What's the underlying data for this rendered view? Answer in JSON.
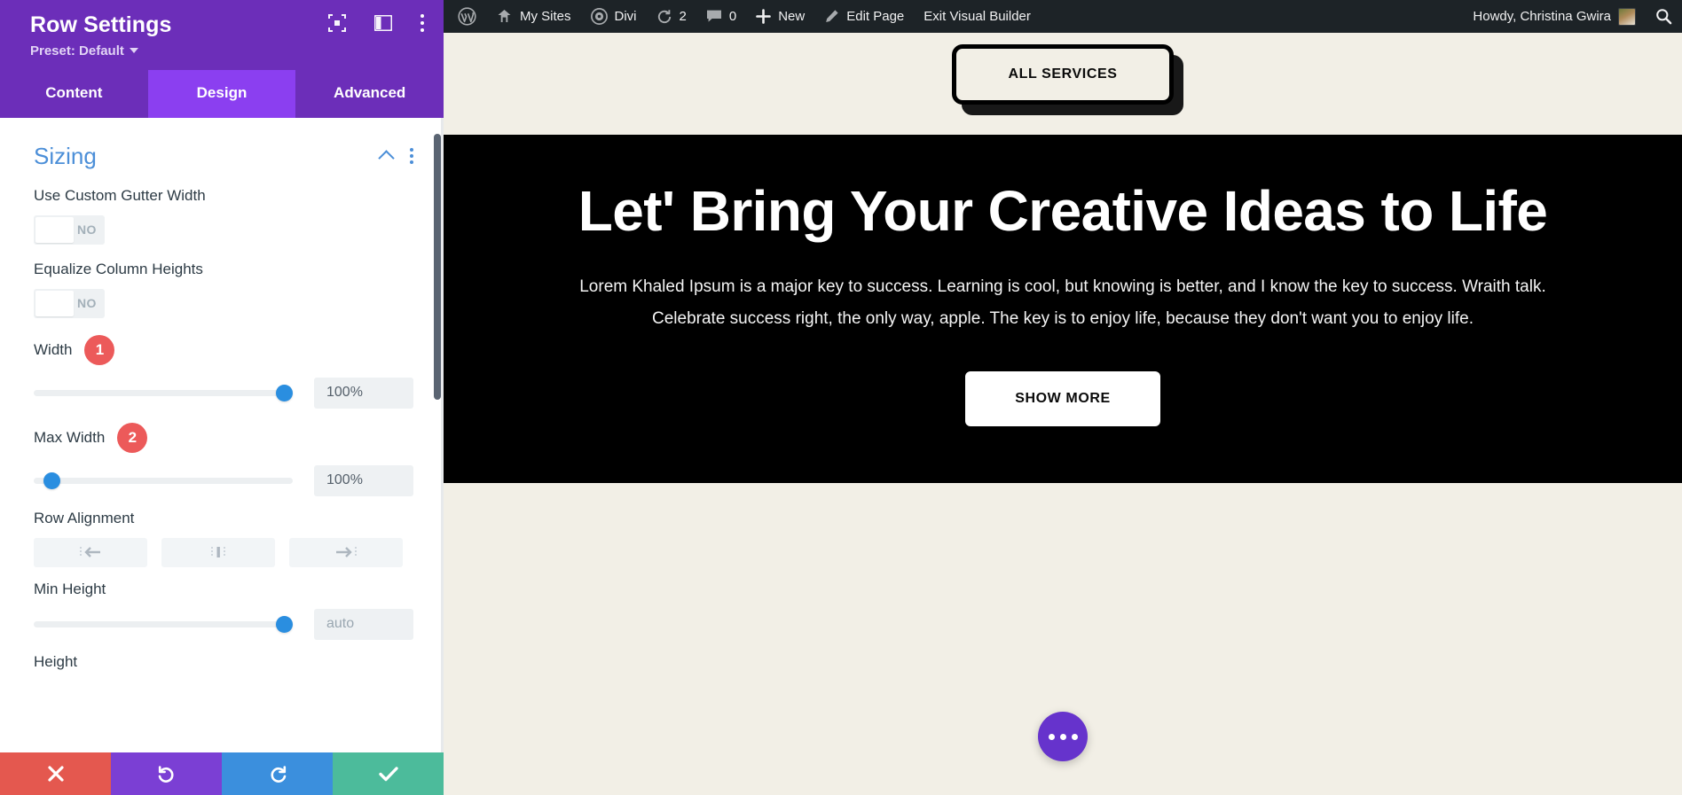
{
  "panel": {
    "title": "Row Settings",
    "preset_label": "Preset: Default",
    "header_icons": [
      "focus-icon",
      "panel-layout-icon",
      "more-options-icon"
    ],
    "tabs": [
      {
        "label": "Content",
        "active": false
      },
      {
        "label": "Design",
        "active": true
      },
      {
        "label": "Advanced",
        "active": false
      }
    ],
    "section": {
      "title": "Sizing",
      "collapsed": false
    },
    "fields": {
      "gutter": {
        "label": "Use Custom Gutter Width",
        "toggle_value": "NO"
      },
      "equalize": {
        "label": "Equalize Column Heights",
        "toggle_value": "NO"
      },
      "width": {
        "label": "Width",
        "badge": "1",
        "value": "100%",
        "slider_percent": 100
      },
      "max_width": {
        "label": "Max Width",
        "badge": "2",
        "value": "100%",
        "slider_percent": 4
      },
      "row_alignment": {
        "label": "Row Alignment",
        "options": [
          "align-left-icon",
          "align-center-icon",
          "align-right-icon"
        ]
      },
      "min_height": {
        "label": "Min Height",
        "placeholder": "auto",
        "slider_percent": 100
      },
      "height": {
        "label": "Height"
      }
    },
    "footer": {
      "discard_label": "discard-changes",
      "undo_label": "undo",
      "redo_label": "redo",
      "save_label": "save-changes"
    }
  },
  "adminbar": {
    "items": [
      {
        "label": "",
        "icon": "wordpress-logo-icon"
      },
      {
        "label": "My Sites",
        "icon": "my-sites-icon"
      },
      {
        "label": "Divi",
        "icon": "divi-icon"
      },
      {
        "label": "2",
        "icon": "updates-icon"
      },
      {
        "label": "0",
        "icon": "comments-icon"
      },
      {
        "label": "New",
        "icon": "plus-icon"
      },
      {
        "label": "Edit Page",
        "icon": "pencil-icon"
      },
      {
        "label": "Exit Visual Builder",
        "icon": ""
      }
    ],
    "howdy": "Howdy, Christina Gwira",
    "search_icon": "search-icon"
  },
  "page": {
    "all_services_button": "ALL SERVICES",
    "heading": "Let' Bring Your Creative Ideas to Life",
    "paragraph": "Lorem Khaled Ipsum is a major key to success. Learning is cool, but knowing is better, and I know the key to success. Wraith talk. Celebrate success right, the only way, apple. The key is to enjoy life, because they don't want you to enjoy life.",
    "show_more_button": "SHOW MORE",
    "fab": "more-actions-fab"
  },
  "colors": {
    "panel_purple": "#6c2eb9",
    "tab_active": "#8b3ff0",
    "section_blue": "#4c8fd8",
    "slider_blue": "#2a8ee0",
    "badge_red": "#ec5a5a",
    "hero_black": "#000000",
    "page_cream": "#f2efe6",
    "fab_purple": "#6633cc"
  }
}
